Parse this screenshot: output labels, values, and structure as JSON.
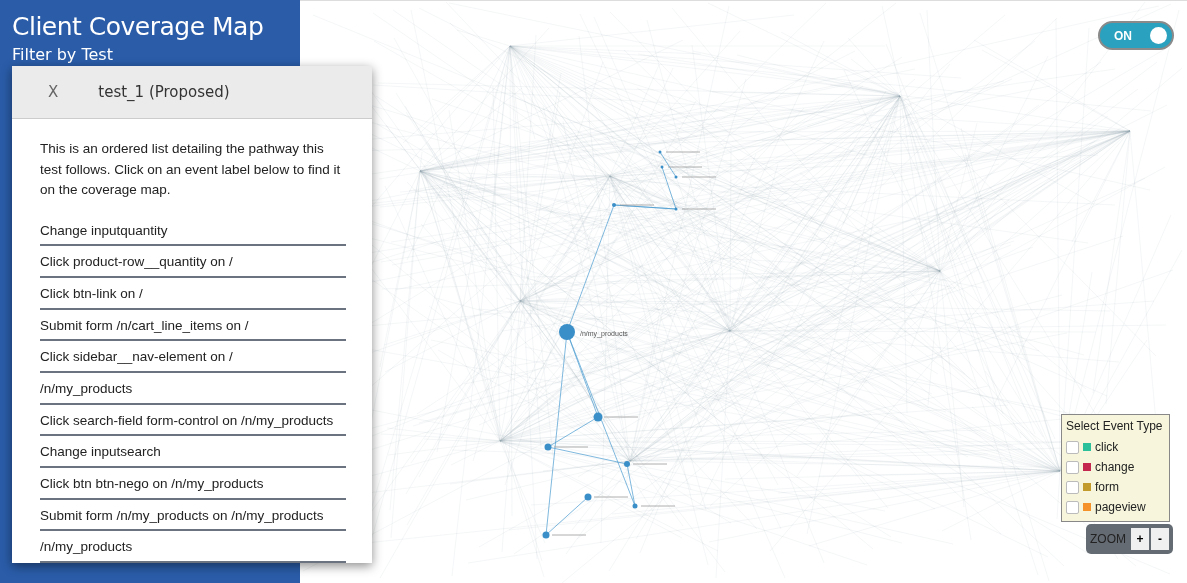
{
  "sidebar": {
    "title": "Client Coverage Map",
    "filter_label": "Filter by Test"
  },
  "dialog": {
    "close": "X",
    "title": "test_1 (Proposed)",
    "description": "This is an ordered list detailing the pathway this test follows. Click on an event label below to find it on the coverage map.",
    "events": [
      "Change inputquantity",
      "Click product-row__quantity on /",
      "Click btn-link on /",
      "Submit form /n/cart_line_items on /",
      "Click sidebar__nav-element on /",
      "/n/my_products",
      "Click search-field form-control on /n/my_products",
      "Change inputsearch",
      "Click btn btn-nego on /n/my_products",
      "Submit form /n/my_products on /n/my_products",
      "/n/my_products"
    ]
  },
  "map": {
    "node_label": "/n/my_products"
  },
  "toggle": {
    "label": "ON",
    "on": true
  },
  "legend": {
    "title": "Select Event Type",
    "items": [
      {
        "label": "click",
        "color": "#2bbf9a",
        "checked": false
      },
      {
        "label": "change",
        "color": "#c4284f",
        "checked": false
      },
      {
        "label": "form",
        "color": "#c39a2c",
        "checked": false
      },
      {
        "label": "pageview",
        "color": "#f5922a",
        "checked": false
      }
    ]
  },
  "zoom": {
    "label": "ZOOM",
    "buttons": [
      "+",
      "-"
    ]
  }
}
